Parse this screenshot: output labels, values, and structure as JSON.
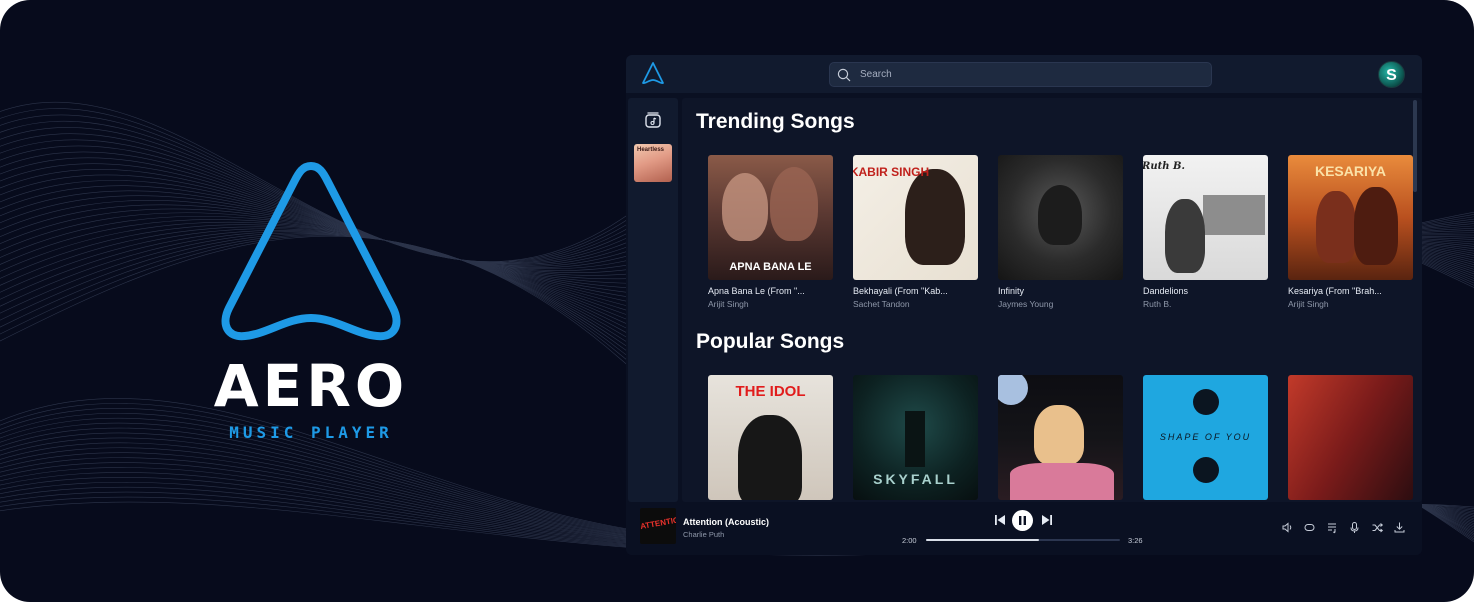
{
  "brand": {
    "title": "AERO",
    "subtitle": "MUSIC PLAYER",
    "accent": "#1e9ae6"
  },
  "topbar": {
    "search_placeholder": "Search",
    "avatar_letter": "S"
  },
  "sidebar": {
    "library_icon": "music-library-icon",
    "thumb_text": "Heartless"
  },
  "sections": {
    "trending": {
      "title": "Trending Songs",
      "songs": [
        {
          "title": "Apna Bana Le (From \"...",
          "artist": "Arijit Singh",
          "cover_text": "APNA BANA LE"
        },
        {
          "title": "Bekhayali (From \"Kab...",
          "artist": "Sachet Tandon",
          "cover_text": "KABIR SINGH"
        },
        {
          "title": "Infinity",
          "artist": "Jaymes Young",
          "cover_text": ""
        },
        {
          "title": "Dandelions",
          "artist": "Ruth B.",
          "cover_text": "Ruth B."
        },
        {
          "title": "Kesariya (From \"Brah...",
          "artist": "Arijit Singh",
          "cover_text": "KESARIYA"
        }
      ]
    },
    "popular": {
      "title": "Popular Songs",
      "songs": [
        {
          "cover_text": "THE IDOL"
        },
        {
          "cover_text": "SKYFALL"
        },
        {
          "cover_text": ""
        },
        {
          "cover_text": "SHAPE OF YOU"
        },
        {
          "cover_text": ""
        }
      ]
    }
  },
  "player": {
    "title": "Attention (Acoustic)",
    "artist": "Charlie Puth",
    "cover_text": "ATTENTION",
    "elapsed": "2:00",
    "duration": "3:26",
    "progress": 0.58
  }
}
